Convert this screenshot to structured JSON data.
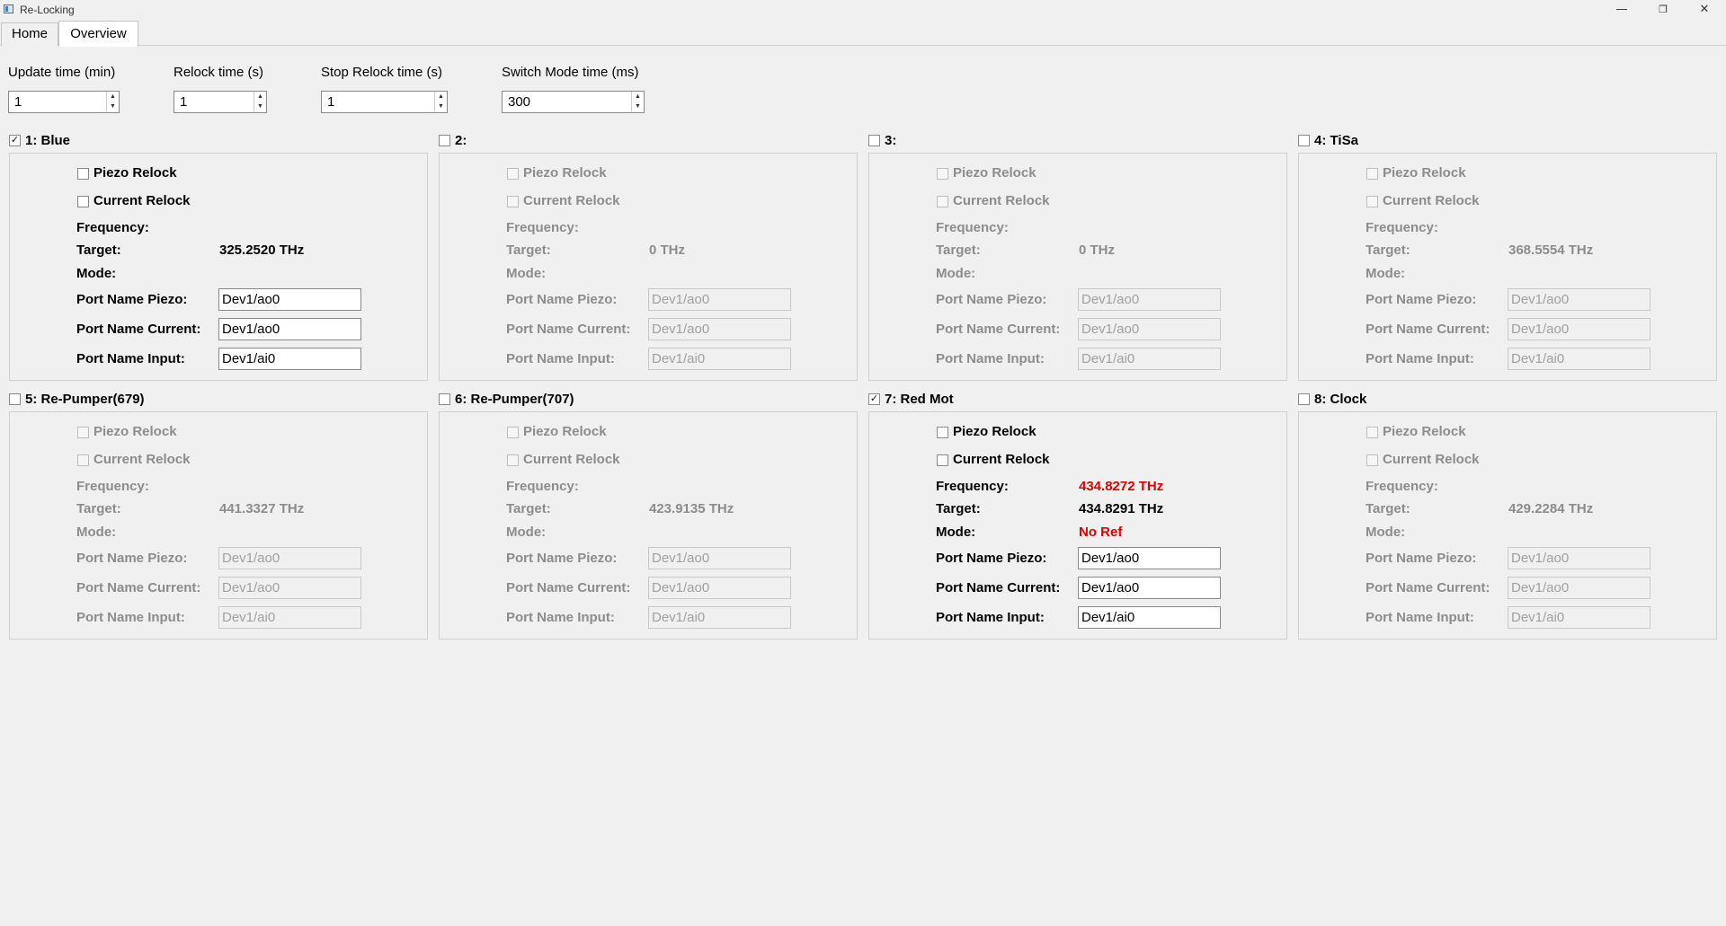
{
  "window": {
    "title": "Re-Locking",
    "minimize_glyph": "—",
    "maximize_glyph": "❐",
    "close_glyph": "✕"
  },
  "tabs": [
    {
      "label": "Home"
    },
    {
      "label": "Overview"
    }
  ],
  "settings": [
    {
      "label": "Update time (min)",
      "value": "1"
    },
    {
      "label": "Relock time (s)",
      "value": "1"
    },
    {
      "label": "Stop Relock time (s)",
      "value": "1"
    },
    {
      "label": "Switch Mode time (ms)",
      "value": "300"
    }
  ],
  "labels": {
    "piezo_relock": "Piezo Relock",
    "current_relock": "Current Relock",
    "frequency": "Frequency:",
    "target": "Target:",
    "mode": "Mode:",
    "port_piezo": "Port Name Piezo:",
    "port_current": "Port Name Current:",
    "port_input": "Port Name Input:"
  },
  "channels": [
    {
      "title": "1: Blue",
      "checked": "✓",
      "frequency": "",
      "target": "325.2520 THz",
      "mode": "",
      "port_piezo": "Dev1/ao0",
      "port_current": "Dev1/ao0",
      "port_input": "Dev1/ai0"
    },
    {
      "title": "2:",
      "checked": "",
      "frequency": "",
      "target": "0 THz",
      "mode": "",
      "port_piezo": "Dev1/ao0",
      "port_current": "Dev1/ao0",
      "port_input": "Dev1/ai0"
    },
    {
      "title": "3:",
      "checked": "",
      "frequency": "",
      "target": "0 THz",
      "mode": "",
      "port_piezo": "Dev1/ao0",
      "port_current": "Dev1/ao0",
      "port_input": "Dev1/ai0"
    },
    {
      "title": "4: TiSa",
      "checked": "",
      "frequency": "",
      "target": "368.5554 THz",
      "mode": "",
      "port_piezo": "Dev1/ao0",
      "port_current": "Dev1/ao0",
      "port_input": "Dev1/ai0"
    },
    {
      "title": "5: Re-Pumper(679)",
      "checked": "",
      "frequency": "",
      "target": "441.3327 THz",
      "mode": "",
      "port_piezo": "Dev1/ao0",
      "port_current": "Dev1/ao0",
      "port_input": "Dev1/ai0"
    },
    {
      "title": "6: Re-Pumper(707)",
      "checked": "",
      "frequency": "",
      "target": "423.9135 THz",
      "mode": "",
      "port_piezo": "Dev1/ao0",
      "port_current": "Dev1/ao0",
      "port_input": "Dev1/ai0"
    },
    {
      "title": "7: Red Mot",
      "checked": "✓",
      "frequency": "434.8272 THz",
      "target": "434.8291 THz",
      "mode": "No Ref",
      "port_piezo": "Dev1/ao0",
      "port_current": "Dev1/ao0",
      "port_input": "Dev1/ai0"
    },
    {
      "title": "8: Clock",
      "checked": "",
      "frequency": "",
      "target": "429.2284 THz",
      "mode": "",
      "port_piezo": "Dev1/ao0",
      "port_current": "Dev1/ao0",
      "port_input": "Dev1/ai0"
    }
  ],
  "colors": {
    "alert": "#e00000",
    "disabled_text": "#8c8c8c",
    "background": "#f0f0f0"
  }
}
